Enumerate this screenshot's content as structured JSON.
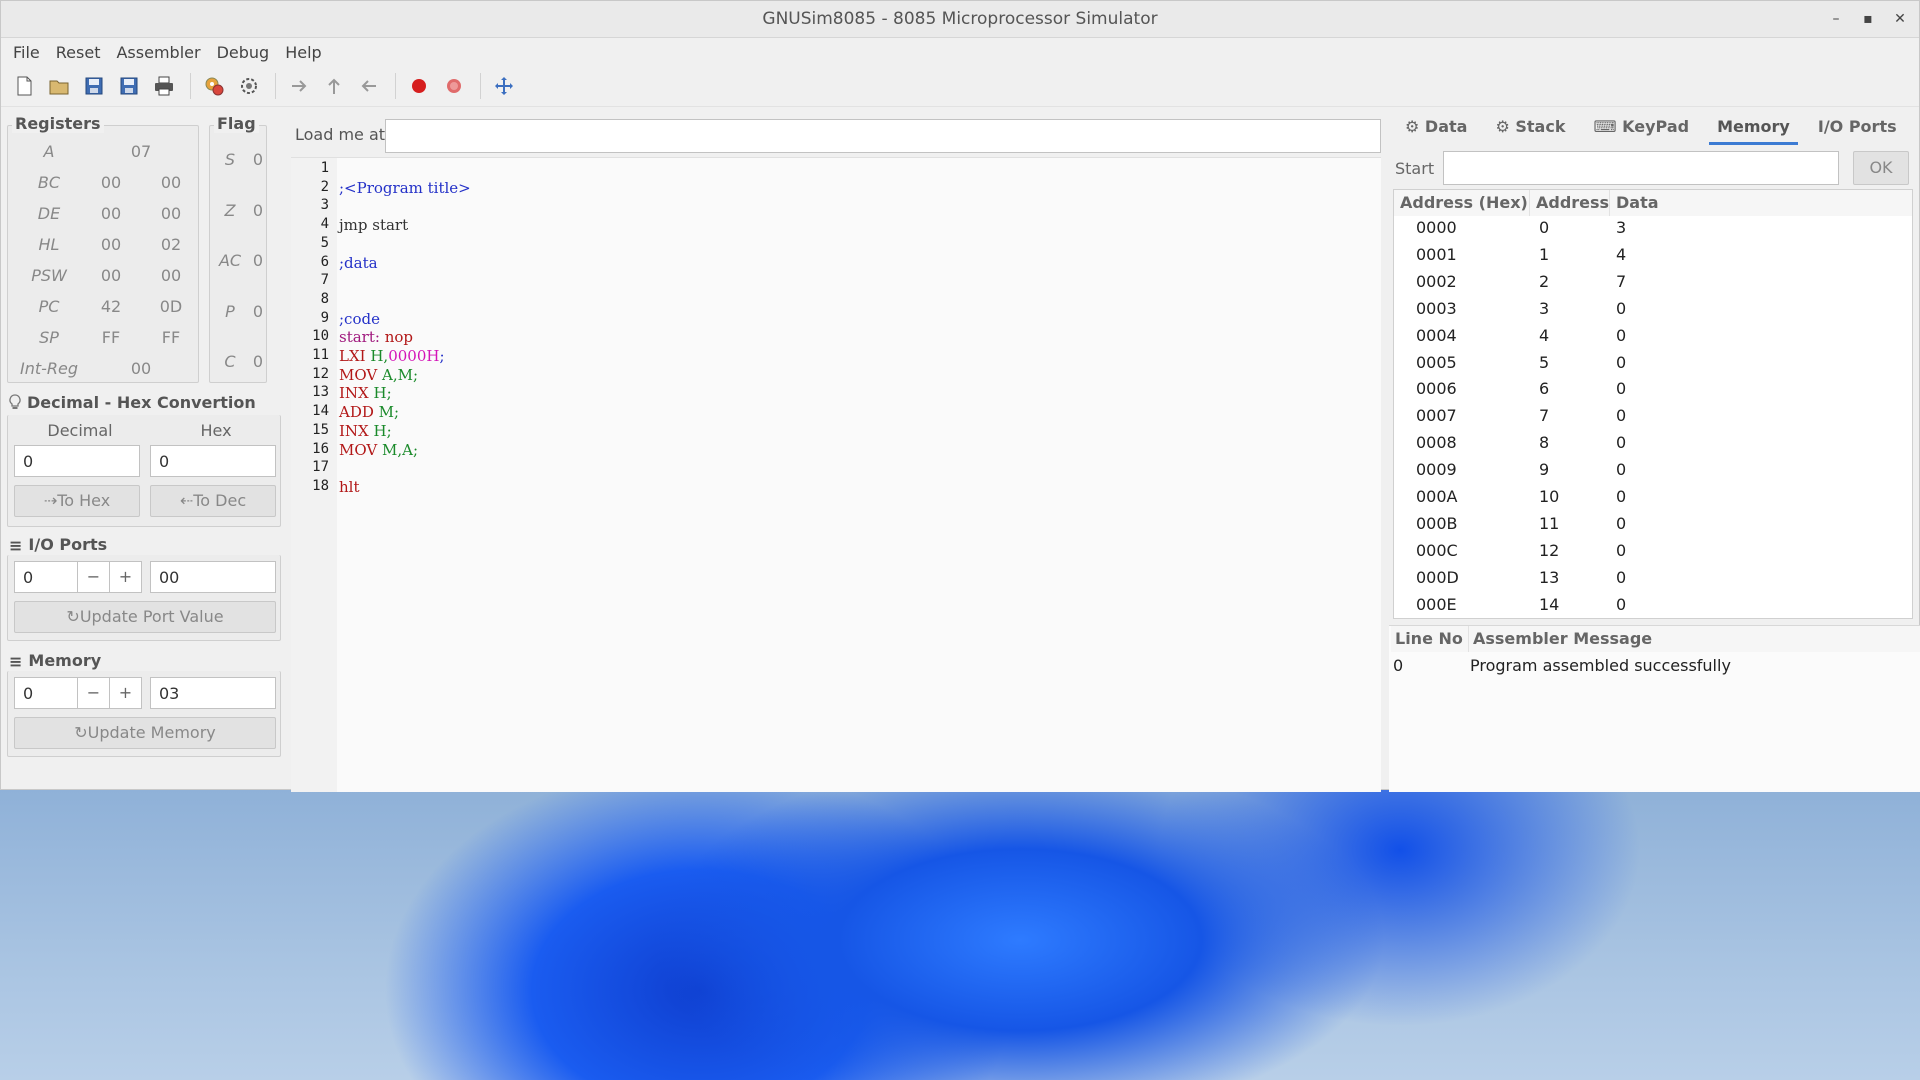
{
  "window": {
    "title": "GNUSim8085 - 8085 Microprocessor Simulator",
    "minimize": "–",
    "maximize": "▪",
    "close": "✕"
  },
  "menu": [
    "File",
    "Reset",
    "Assembler",
    "Debug",
    "Help"
  ],
  "toolbar_icons": [
    "new-icon",
    "open-icon",
    "save-icon",
    "save-as-icon",
    "print-icon",
    "assemble-icon",
    "execute-icon",
    "step-in-icon",
    "step-over-icon",
    "step-out-icon",
    "breakpoint-icon",
    "clear-breakpoints-icon",
    "fullscreen-icon"
  ],
  "registers": {
    "title": "Registers",
    "rows": [
      {
        "name": "A",
        "v1": "",
        "v2": "",
        "single": "07"
      },
      {
        "name": "BC",
        "v1": "00",
        "v2": "00"
      },
      {
        "name": "DE",
        "v1": "00",
        "v2": "00"
      },
      {
        "name": "HL",
        "v1": "00",
        "v2": "02"
      },
      {
        "name": "PSW",
        "v1": "00",
        "v2": "00"
      },
      {
        "name": "PC",
        "v1": "42",
        "v2": "0D"
      },
      {
        "name": "SP",
        "v1": "FF",
        "v2": "FF"
      },
      {
        "name": "Int-Reg",
        "v1": "",
        "v2": "",
        "single": "00"
      }
    ]
  },
  "flags": {
    "title": "Flag",
    "rows": [
      {
        "name": "S",
        "val": "0"
      },
      {
        "name": "Z",
        "val": "0"
      },
      {
        "name": "AC",
        "val": "0"
      },
      {
        "name": "P",
        "val": "0"
      },
      {
        "name": "C",
        "val": "0"
      }
    ]
  },
  "conversion": {
    "title": "Decimal - Hex Convertion",
    "decimal_label": "Decimal",
    "hex_label": "Hex",
    "decimal_value": "0",
    "hex_value": "0",
    "to_hex": "To Hex",
    "to_dec": "To Dec"
  },
  "io_ports": {
    "title": "I/O Ports",
    "port": "0",
    "minus": "−",
    "plus": "+",
    "value": "00",
    "update": "Update Port Value"
  },
  "memory_panel": {
    "title": "Memory",
    "address": "0",
    "minus": "−",
    "plus": "+",
    "value": "03",
    "update": "Update Memory"
  },
  "editor": {
    "load_label": "Load me at",
    "load_value": "",
    "lines": [
      {
        "n": "1",
        "segs": []
      },
      {
        "n": "2",
        "segs": [
          {
            "t": ";<Program title>",
            "c": "#2431c8"
          }
        ]
      },
      {
        "n": "3",
        "segs": []
      },
      {
        "n": "4",
        "segs": [
          {
            "t": "jmp start",
            "c": "#333333"
          }
        ]
      },
      {
        "n": "5",
        "segs": []
      },
      {
        "n": "6",
        "segs": [
          {
            "t": ";data",
            "c": "#2431c8"
          }
        ]
      },
      {
        "n": "7",
        "segs": []
      },
      {
        "n": "8",
        "segs": []
      },
      {
        "n": "9",
        "segs": [
          {
            "t": ";code",
            "c": "#2431c8"
          }
        ]
      },
      {
        "n": "10",
        "segs": [
          {
            "t": "start: ",
            "c": "#a0197e"
          },
          {
            "t": "nop",
            "c": "#b21818"
          }
        ]
      },
      {
        "n": "11",
        "segs": [
          {
            "t": "LXI ",
            "c": "#b21818"
          },
          {
            "t": "H,",
            "c": "#1a8a2a"
          },
          {
            "t": "0000H",
            "c": "#d414b8"
          },
          {
            "t": ";",
            "c": "#2431c8"
          }
        ]
      },
      {
        "n": "12",
        "segs": [
          {
            "t": "MOV ",
            "c": "#b21818"
          },
          {
            "t": "A,M;",
            "c": "#1a8a2a"
          }
        ]
      },
      {
        "n": "13",
        "segs": [
          {
            "t": "INX ",
            "c": "#b21818"
          },
          {
            "t": "H;",
            "c": "#1a8a2a"
          }
        ]
      },
      {
        "n": "14",
        "segs": [
          {
            "t": "ADD ",
            "c": "#b21818"
          },
          {
            "t": "M;",
            "c": "#1a8a2a"
          }
        ]
      },
      {
        "n": "15",
        "segs": [
          {
            "t": "INX ",
            "c": "#b21818"
          },
          {
            "t": "H;",
            "c": "#1a8a2a"
          }
        ]
      },
      {
        "n": "16",
        "segs": [
          {
            "t": "MOV ",
            "c": "#b21818"
          },
          {
            "t": "M,A;",
            "c": "#1a8a2a"
          }
        ]
      },
      {
        "n": "17",
        "segs": []
      },
      {
        "n": "18",
        "segs": [
          {
            "t": "hlt",
            "c": "#b21818"
          }
        ]
      }
    ]
  },
  "tabs": [
    {
      "label": "Data",
      "icon": "gear-icon"
    },
    {
      "label": "Stack",
      "icon": "gear-icon"
    },
    {
      "label": "KeyPad",
      "icon": "keypad-icon"
    },
    {
      "label": "Memory",
      "icon": "",
      "active": true
    },
    {
      "label": "I/O Ports",
      "icon": ""
    }
  ],
  "memory_view": {
    "start_label": "Start",
    "start_value": "",
    "ok": "OK",
    "headers": [
      "Address (Hex)",
      "Address",
      "Data"
    ],
    "rows": [
      [
        "0000",
        "0",
        "3"
      ],
      [
        "0001",
        "1",
        "4"
      ],
      [
        "0002",
        "2",
        "7"
      ],
      [
        "0003",
        "3",
        "0"
      ],
      [
        "0004",
        "4",
        "0"
      ],
      [
        "0005",
        "5",
        "0"
      ],
      [
        "0006",
        "6",
        "0"
      ],
      [
        "0007",
        "7",
        "0"
      ],
      [
        "0008",
        "8",
        "0"
      ],
      [
        "0009",
        "9",
        "0"
      ],
      [
        "000A",
        "10",
        "0"
      ],
      [
        "000B",
        "11",
        "0"
      ],
      [
        "000C",
        "12",
        "0"
      ],
      [
        "000D",
        "13",
        "0"
      ],
      [
        "000E",
        "14",
        "0"
      ]
    ]
  },
  "assembler": {
    "headers": [
      "Line No",
      "Assembler Message"
    ],
    "rows": [
      [
        "0",
        "Program assembled successfully"
      ]
    ]
  }
}
